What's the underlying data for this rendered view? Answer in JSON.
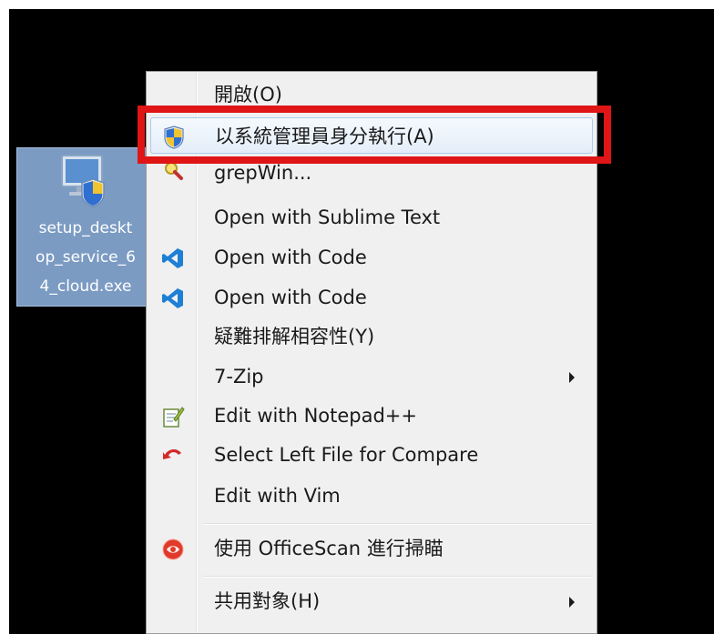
{
  "desktop": {
    "file": {
      "label": "setup_deskt\nop_service_6\n4_cloud.exe",
      "icon": "installer-shield-icon"
    }
  },
  "menu": {
    "items": [
      {
        "label": "開啟(O)",
        "icon": null,
        "submenu": false
      },
      {
        "label": "以系統管理員身分執行(A)",
        "icon": "uac-shield-icon",
        "submenu": false
      },
      {
        "label": "grepWin...",
        "icon": "magnifier-icon",
        "submenu": false
      },
      {
        "label": "Open with Sublime Text",
        "icon": null,
        "submenu": false
      },
      {
        "label": "Open with Code",
        "icon": "vscode-icon",
        "submenu": false
      },
      {
        "label": "Open with Code",
        "icon": "vscode-icon",
        "submenu": false
      },
      {
        "label": "疑難排解相容性(Y)",
        "icon": null,
        "submenu": false
      },
      {
        "label": "7-Zip",
        "icon": null,
        "submenu": true
      },
      {
        "label": "Edit with Notepad++",
        "icon": "notepadpp-icon",
        "submenu": false
      },
      {
        "label": "Select Left File for Compare",
        "icon": "compare-arrow-icon",
        "submenu": false
      },
      {
        "label": "Edit with Vim",
        "icon": null,
        "submenu": false
      },
      {
        "label": "使用 OfficeScan 進行掃瞄",
        "icon": "officescan-icon",
        "submenu": false
      },
      {
        "label": "共用對象(H)",
        "icon": null,
        "submenu": true
      }
    ]
  },
  "highlight": {
    "color": "#e01515"
  }
}
